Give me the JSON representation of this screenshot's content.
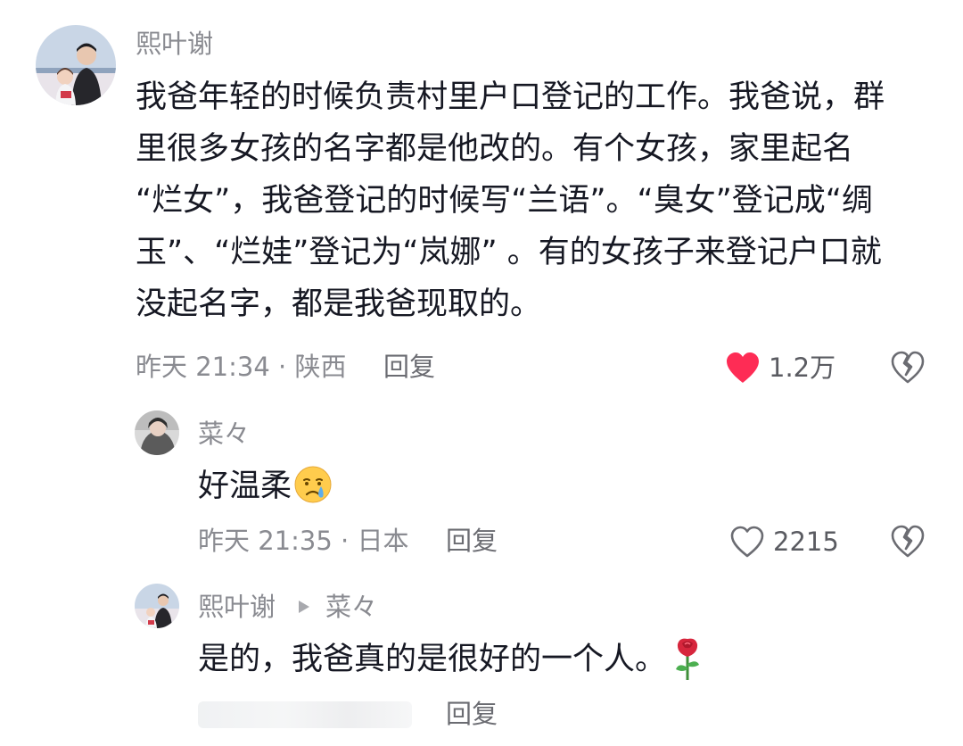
{
  "comments": [
    {
      "username": "熙叶谢",
      "lines": [
        "我爸年轻的时候负责村里户口登记的工作。我爸说，群",
        "里很多女孩的名字都是他改的。有个女孩，家里起名",
        "“烂女”，我爸登记的时候写“兰语”。“臭女”登记成“绸",
        "玉”、“烂娃”登记为“岚娜” 。有的女孩子来登记户口就",
        "没起名字，都是我爸现取的。"
      ],
      "meta": "昨天 21:34 · 陕西",
      "reply_label": "回复",
      "like_count": "1.2万",
      "liked": true,
      "like_color": "#fe2c55"
    },
    {
      "username": "菜々",
      "text": "好温柔",
      "emoji": "crying-face-emoji",
      "meta": "昨天 21:35 · 日本",
      "reply_label": "回复",
      "like_count": "2215",
      "liked": false
    },
    {
      "username": "熙叶谢",
      "reply_to": "菜々",
      "text": "是的，我爸真的是很好的一个人。",
      "emoji": "rose-emoji",
      "reply_label": "回复"
    }
  ],
  "icons": {
    "like": "heart-icon",
    "dislike": "broken-heart-icon",
    "reply_arrow": "triangle-right-icon"
  }
}
